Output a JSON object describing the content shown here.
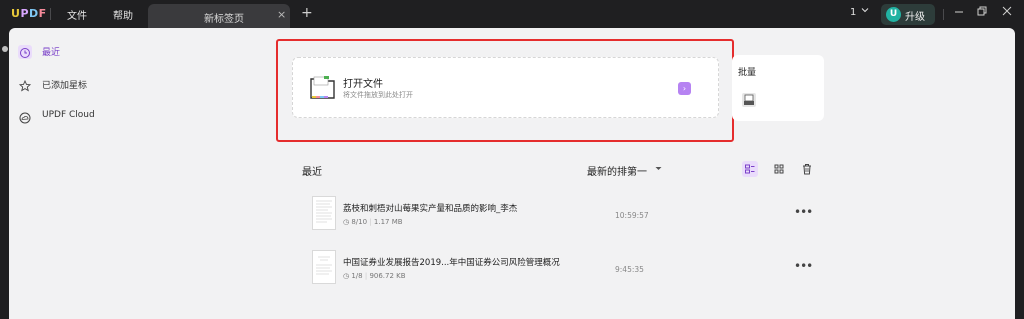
{
  "app": {
    "logo": {
      "u": "U",
      "p": "P",
      "d": "D",
      "f": "F"
    },
    "menu": {
      "file": "文件",
      "help": "帮助"
    },
    "tab": {
      "title": "新标签页",
      "close": "×",
      "add": "+"
    },
    "version_count": "1",
    "upgrade": {
      "badge": "U",
      "label": "升级"
    }
  },
  "sidebar": {
    "items": [
      {
        "label": "最近",
        "icon": "clock-icon",
        "active": true
      },
      {
        "label": "已添加星标",
        "icon": "star-icon",
        "active": false
      },
      {
        "label": "UPDF Cloud",
        "icon": "cloud-icon",
        "active": false
      }
    ]
  },
  "open_card": {
    "title": "打开文件",
    "subtitle": "将文件拖放到此处打开",
    "arrow": "›"
  },
  "batch": {
    "label": "批量"
  },
  "recent": {
    "title": "最近",
    "sort_label": "最新的排第一",
    "files": [
      {
        "name": "荔枝和刺梧对山莓果实产量和品质的影响_李杰",
        "pages": "8/10",
        "size": "1.17 MB",
        "time": "10:59:57"
      },
      {
        "name": "中国证券业发展报告2019...年中国证券公司风险管理概况",
        "pages": "1/8",
        "size": "906.72 KB",
        "time": "9:45:35"
      }
    ]
  },
  "colors": {
    "accent": "#7b41c9",
    "highlight": "#e52d2d"
  }
}
